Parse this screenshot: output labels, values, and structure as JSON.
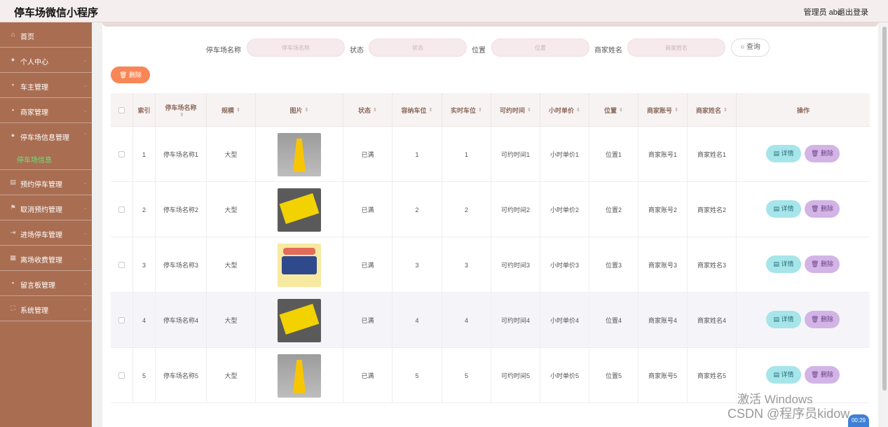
{
  "header": {
    "app_title": "停车场微信小程序",
    "admin_label": "管理员 abo",
    "logout_label": "退出登录"
  },
  "sidebar": {
    "items": [
      {
        "label": "首页",
        "icon": "home-icon"
      },
      {
        "label": "个人中心",
        "icon": "user-icon"
      },
      {
        "label": "车主管理",
        "icon": "car-icon"
      },
      {
        "label": "商家管理",
        "icon": "shop-icon"
      },
      {
        "label": "停车场信息管理",
        "icon": "user-icon"
      },
      {
        "label": "预约停车管理",
        "icon": "calendar-icon"
      },
      {
        "label": "取消预约管理",
        "icon": "flag-icon"
      },
      {
        "label": "进场停车管理",
        "icon": "enter-icon"
      },
      {
        "label": "离场收费管理",
        "icon": "grid-icon"
      },
      {
        "label": "留言板管理",
        "icon": "message-icon"
      },
      {
        "label": "系统管理",
        "icon": "settings-icon"
      }
    ],
    "active_sub_item": "停车场信息",
    "accent_color": "#a96e52",
    "active_color": "#6fe07a"
  },
  "search": {
    "name_label": "停车场名称",
    "name_placeholder": "停车场名称",
    "status_label": "状态",
    "status_placeholder": "状态",
    "location_label": "位置",
    "location_placeholder": "位置",
    "merchant_label": "商家姓名",
    "merchant_placeholder": "商家姓名",
    "query_label": "查询"
  },
  "toolbar": {
    "delete_label": "删除"
  },
  "table": {
    "columns": [
      "索引",
      "停车场名称",
      "规模",
      "图片",
      "状态",
      "容纳车位",
      "实时车位",
      "可约时间",
      "小时单价",
      "位置",
      "商家账号",
      "商家姓名",
      "操作"
    ],
    "rows": [
      {
        "index": "1",
        "name": "停车场名称1",
        "scale": "大型",
        "image": "yellow-sign",
        "status": "已满",
        "capacity": "1",
        "realtime": "1",
        "time": "可约时间1",
        "price": "小时单价1",
        "location": "位置1",
        "account": "商家账号1",
        "merchant": "商家姓名1"
      },
      {
        "index": "2",
        "name": "停车场名称2",
        "scale": "大型",
        "image": "yellow-floor-mat",
        "status": "已满",
        "capacity": "2",
        "realtime": "2",
        "time": "可约时间2",
        "price": "小时单价2",
        "location": "位置2",
        "account": "商家账号2",
        "merchant": "商家姓名2"
      },
      {
        "index": "3",
        "name": "停车场名称3",
        "scale": "大型",
        "image": "parking-poster",
        "status": "已满",
        "capacity": "3",
        "realtime": "3",
        "time": "可约时间3",
        "price": "小时单价3",
        "location": "位置3",
        "account": "商家账号3",
        "merchant": "商家姓名3"
      },
      {
        "index": "4",
        "name": "停车场名称4",
        "scale": "大型",
        "image": "yellow-floor-mat",
        "status": "已满",
        "capacity": "4",
        "realtime": "4",
        "time": "可约时间4",
        "price": "小时单价4",
        "location": "位置4",
        "account": "商家账号4",
        "merchant": "商家姓名4"
      },
      {
        "index": "5",
        "name": "停车场名称5",
        "scale": "大型",
        "image": "yellow-sign",
        "status": "已满",
        "capacity": "5",
        "realtime": "5",
        "time": "可约时间5",
        "price": "小时单价5",
        "location": "位置5",
        "account": "商家账号5",
        "merchant": "商家姓名5"
      }
    ],
    "detail_label": "详情",
    "delete_label": "删除"
  },
  "overlay": {
    "watermark_line1": "激活 Windows",
    "watermark_line2": "CSDN @程序员kidow",
    "timer": "00:29"
  }
}
